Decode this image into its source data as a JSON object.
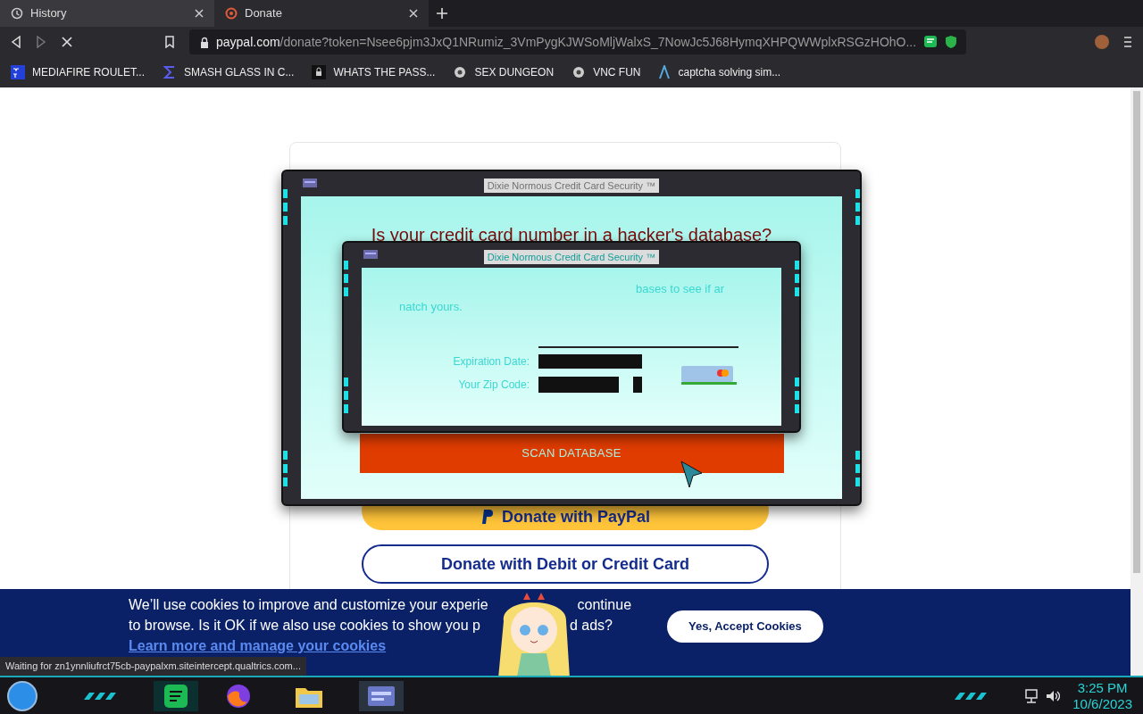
{
  "browser": {
    "tabs": [
      {
        "title": "History",
        "kind": "history",
        "selected": false
      },
      {
        "title": "Donate",
        "kind": "site",
        "selected": true
      }
    ],
    "address": {
      "domain": "paypal.com",
      "path": "/donate?token=Nsee6pjm3JxQ1NRumiz_3VmPygKJWSoMljWalxS_7NowJc5J68HymqXHPQWWplxRSGzHOhO..."
    },
    "bookmarks": [
      {
        "label": "MEDIAFIRE ROULET...",
        "kind": "mf"
      },
      {
        "label": "SMASH GLASS IN C...",
        "kind": "sigma"
      },
      {
        "label": "WHATS THE PASS...",
        "kind": "lock"
      },
      {
        "label": "SEX DUNGEON",
        "kind": "gear"
      },
      {
        "label": "VNC FUN",
        "kind": "gear"
      },
      {
        "label": "captcha solving sim...",
        "kind": "lambda"
      }
    ],
    "status": "Waiting for zn1ynnliufrct75cb-paypalxm.siteintercept.qualtrics.com..."
  },
  "page": {
    "buttons": [
      {
        "label": "Donate with PayPal",
        "kind": "paypal"
      },
      {
        "label": "Donate with Debit or Credit Card",
        "kind": "card"
      }
    ]
  },
  "popups": [
    {
      "title": "Dixie Normous Credit Card Security ™",
      "heading": "Is your credit card number in a hacker's database?",
      "button": "SCAN DATABASE"
    },
    {
      "title": "Dixie Normous Credit Card Security ™",
      "text_lines": [
        "bases to see if ar",
        "natch yours."
      ],
      "fields": [
        {
          "label": "Expiration Date:"
        },
        {
          "label": "Your Zip Code:"
        }
      ]
    }
  ],
  "cookie_banner": {
    "lines": [
      [
        "We’ll use cookies to improve and customize your experie",
        "continue"
      ],
      [
        "to browse. Is it OK if we also use cookies to show you p",
        "d ads?"
      ]
    ],
    "link": "Learn more and manage your cookies",
    "button": "Yes, Accept Cookies"
  },
  "taskbar": {
    "time": "3:25 PM",
    "date": "10/6/2023"
  }
}
